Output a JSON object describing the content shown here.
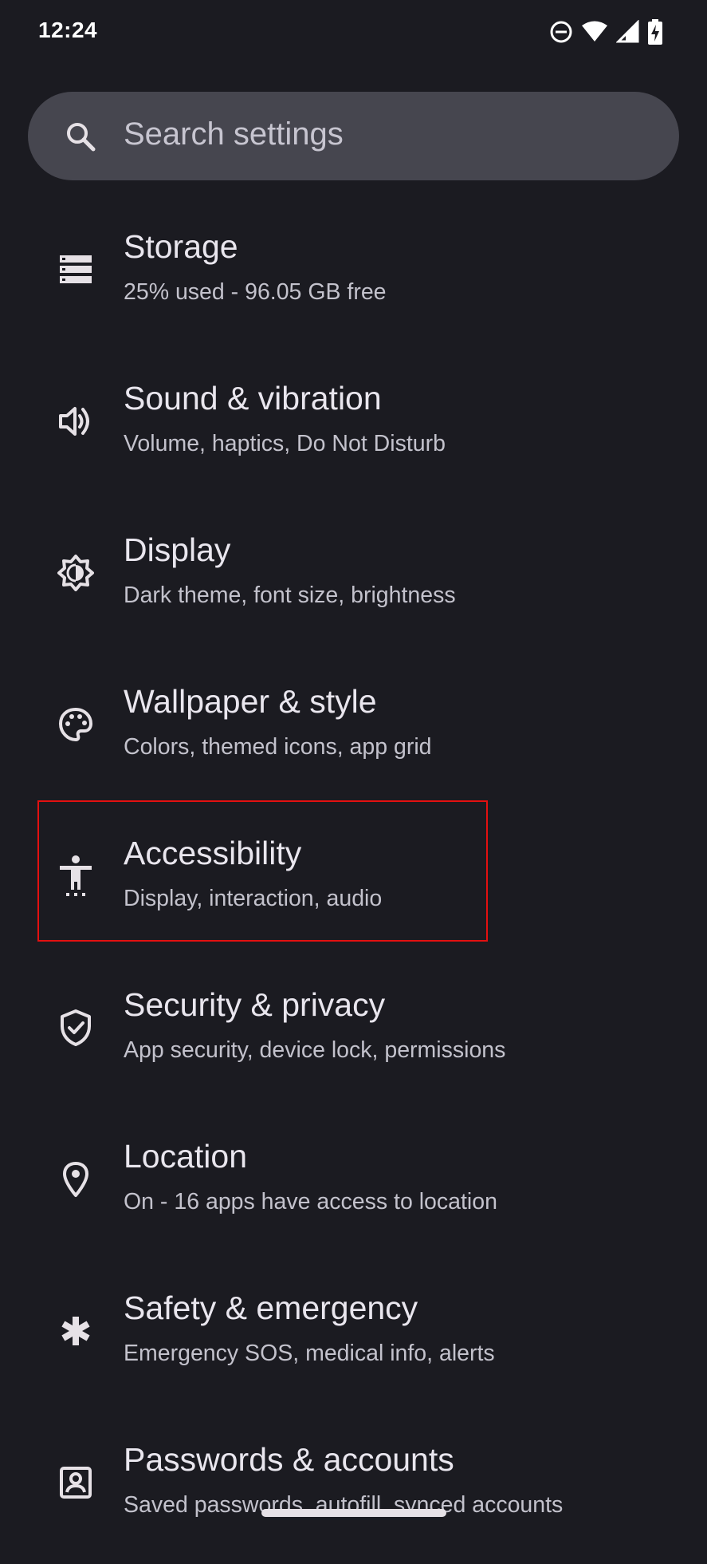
{
  "status_bar": {
    "time": "12:24",
    "icons": [
      "do-not-disturb-icon",
      "wifi-icon",
      "cellular-signal-icon",
      "battery-charging-icon"
    ]
  },
  "search": {
    "placeholder": "Search settings",
    "icon": "search-icon"
  },
  "settings_items": [
    {
      "title": "Storage",
      "subtitle": "25% used - 96.05 GB free",
      "icon": "storage-icon"
    },
    {
      "title": "Sound & vibration",
      "subtitle": "Volume, haptics, Do Not Disturb",
      "icon": "volume-icon"
    },
    {
      "title": "Display",
      "subtitle": "Dark theme, font size, brightness",
      "icon": "brightness-icon"
    },
    {
      "title": "Wallpaper & style",
      "subtitle": "Colors, themed icons, app grid",
      "icon": "palette-icon"
    },
    {
      "title": "Accessibility",
      "subtitle": "Display, interaction, audio",
      "icon": "accessibility-icon"
    },
    {
      "title": "Security & privacy",
      "subtitle": "App security, device lock, permissions",
      "icon": "shield-check-icon"
    },
    {
      "title": "Location",
      "subtitle": "On - 16 apps have access to location",
      "icon": "location-pin-icon"
    },
    {
      "title": "Safety & emergency",
      "subtitle": "Emergency SOS, medical info, alerts",
      "icon": "asterisk-icon"
    },
    {
      "title": "Passwords & accounts",
      "subtitle": "Saved passwords, autofill, synced accounts",
      "icon": "account-box-icon"
    }
  ],
  "highlighted_item": "Accessibility",
  "colors": {
    "background": "#1b1b21",
    "search_bar": "#46464f",
    "title_text": "#e9e6ee",
    "subtitle_text": "#c3c2cc",
    "highlight_border": "#e31010"
  }
}
